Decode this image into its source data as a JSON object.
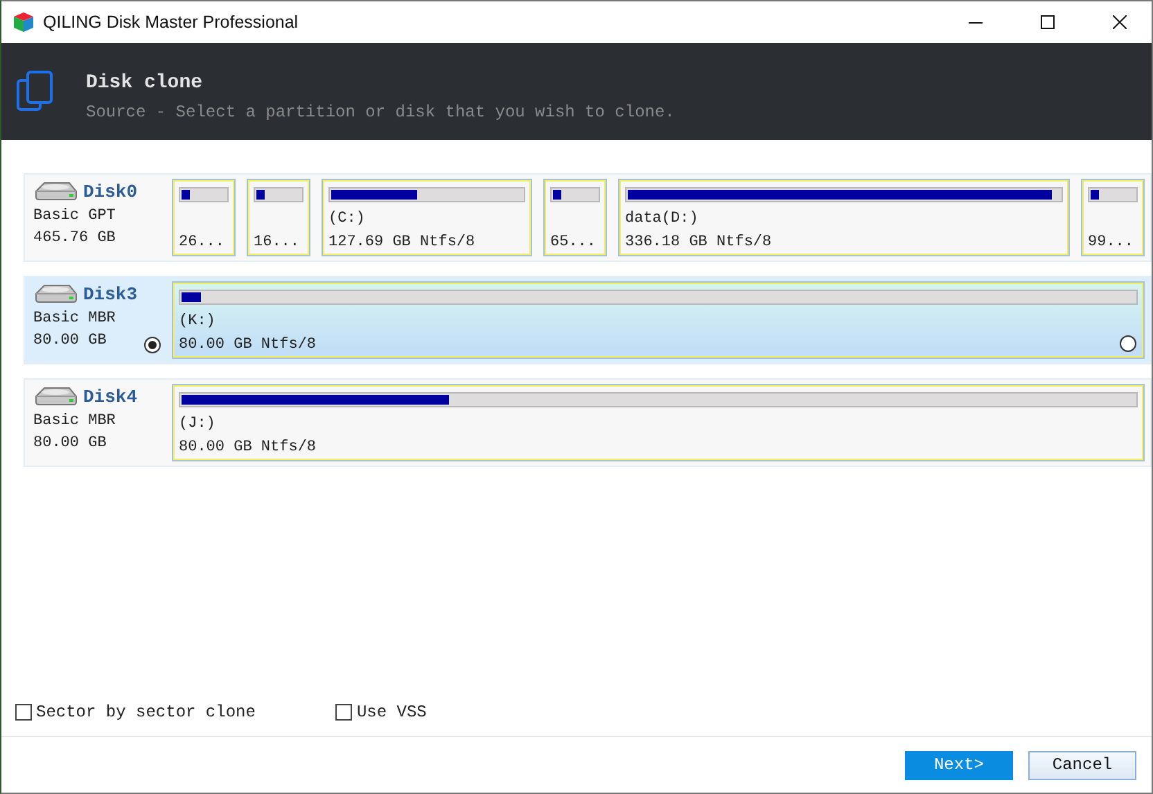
{
  "window": {
    "title": "QILING Disk Master Professional"
  },
  "header": {
    "title": "Disk clone",
    "subtitle": "Source - Select a partition or disk that you wish to clone."
  },
  "disks": [
    {
      "name": "Disk0",
      "type": "Basic GPT",
      "size": "465.76 GB",
      "selected": false,
      "partitions": [
        {
          "kind": "small",
          "level": 0.2,
          "label": "26..."
        },
        {
          "kind": "small",
          "level": 0.2,
          "label": "16..."
        },
        {
          "kind": "medium",
          "level": 0.45,
          "name": "(C:)",
          "label": "127.69 GB Ntfs/8"
        },
        {
          "kind": "small",
          "level": 0.2,
          "label": "65..."
        },
        {
          "kind": "large",
          "level": 0.98,
          "name": "data(D:)",
          "label": "336.18 GB Ntfs/8"
        },
        {
          "kind": "small",
          "level": 0.2,
          "label": "99..."
        }
      ]
    },
    {
      "name": "Disk3",
      "type": "Basic MBR",
      "size": "80.00 GB",
      "selected": true,
      "partitions": [
        {
          "kind": "large",
          "level": 0.02,
          "name": "(K:)",
          "label": "80.00 GB Ntfs/8",
          "selected": false
        }
      ]
    },
    {
      "name": "Disk4",
      "type": "Basic MBR",
      "size": "80.00 GB",
      "selected": false,
      "partitions": [
        {
          "kind": "large",
          "level": 0.28,
          "name": "(J:)",
          "label": "80.00 GB Ntfs/8"
        }
      ]
    }
  ],
  "options": [
    {
      "label": "Sector by sector clone",
      "checked": false
    },
    {
      "label": "Use VSS",
      "checked": false
    }
  ],
  "buttons": [
    {
      "label": "Next>",
      "kind": "primary"
    },
    {
      "label": "Cancel",
      "kind": "secondary"
    }
  ]
}
